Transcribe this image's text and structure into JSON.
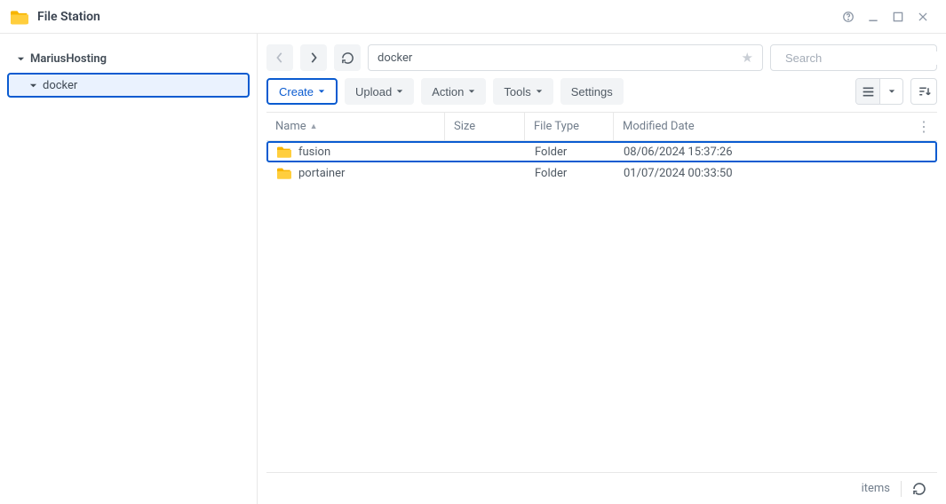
{
  "app": {
    "title": "File Station"
  },
  "window_controls": {
    "help_icon": "help-icon",
    "minimize_icon": "minimize-icon",
    "maximize_icon": "maximize-icon",
    "close_icon": "close-icon"
  },
  "sidebar": {
    "root": {
      "label": "MariusHosting",
      "expanded": true
    },
    "children": [
      {
        "label": "docker",
        "selected": true,
        "expanded": true
      }
    ]
  },
  "path_bar": {
    "value": "docker",
    "starred": false
  },
  "search": {
    "placeholder": "Search"
  },
  "toolbar": {
    "back_icon": "chevron-left-icon",
    "forward_icon": "chevron-right-icon",
    "reload_icon": "reload-icon",
    "create_label": "Create",
    "upload_label": "Upload",
    "action_label": "Action",
    "tools_label": "Tools",
    "settings_label": "Settings",
    "list_view_icon": "list-view-icon",
    "view_dropdown_icon": "chevron-down-icon",
    "sort_icon": "sort-icon"
  },
  "table": {
    "columns": {
      "name": "Name",
      "size": "Size",
      "file_type": "File Type",
      "modified": "Modified Date"
    },
    "sort_column": "name",
    "sort_dir": "asc",
    "rows": [
      {
        "name": "fusion",
        "size": "",
        "file_type": "Folder",
        "modified": "08/06/2024 15:37:26",
        "selected": true
      },
      {
        "name": "portainer",
        "size": "",
        "file_type": "Folder",
        "modified": "01/07/2024 00:33:50",
        "selected": false
      }
    ]
  },
  "footer": {
    "items_label": "items",
    "reload_icon": "reload-icon"
  },
  "colors": {
    "accent": "#0a5bd0",
    "folder": "#f7b500"
  }
}
